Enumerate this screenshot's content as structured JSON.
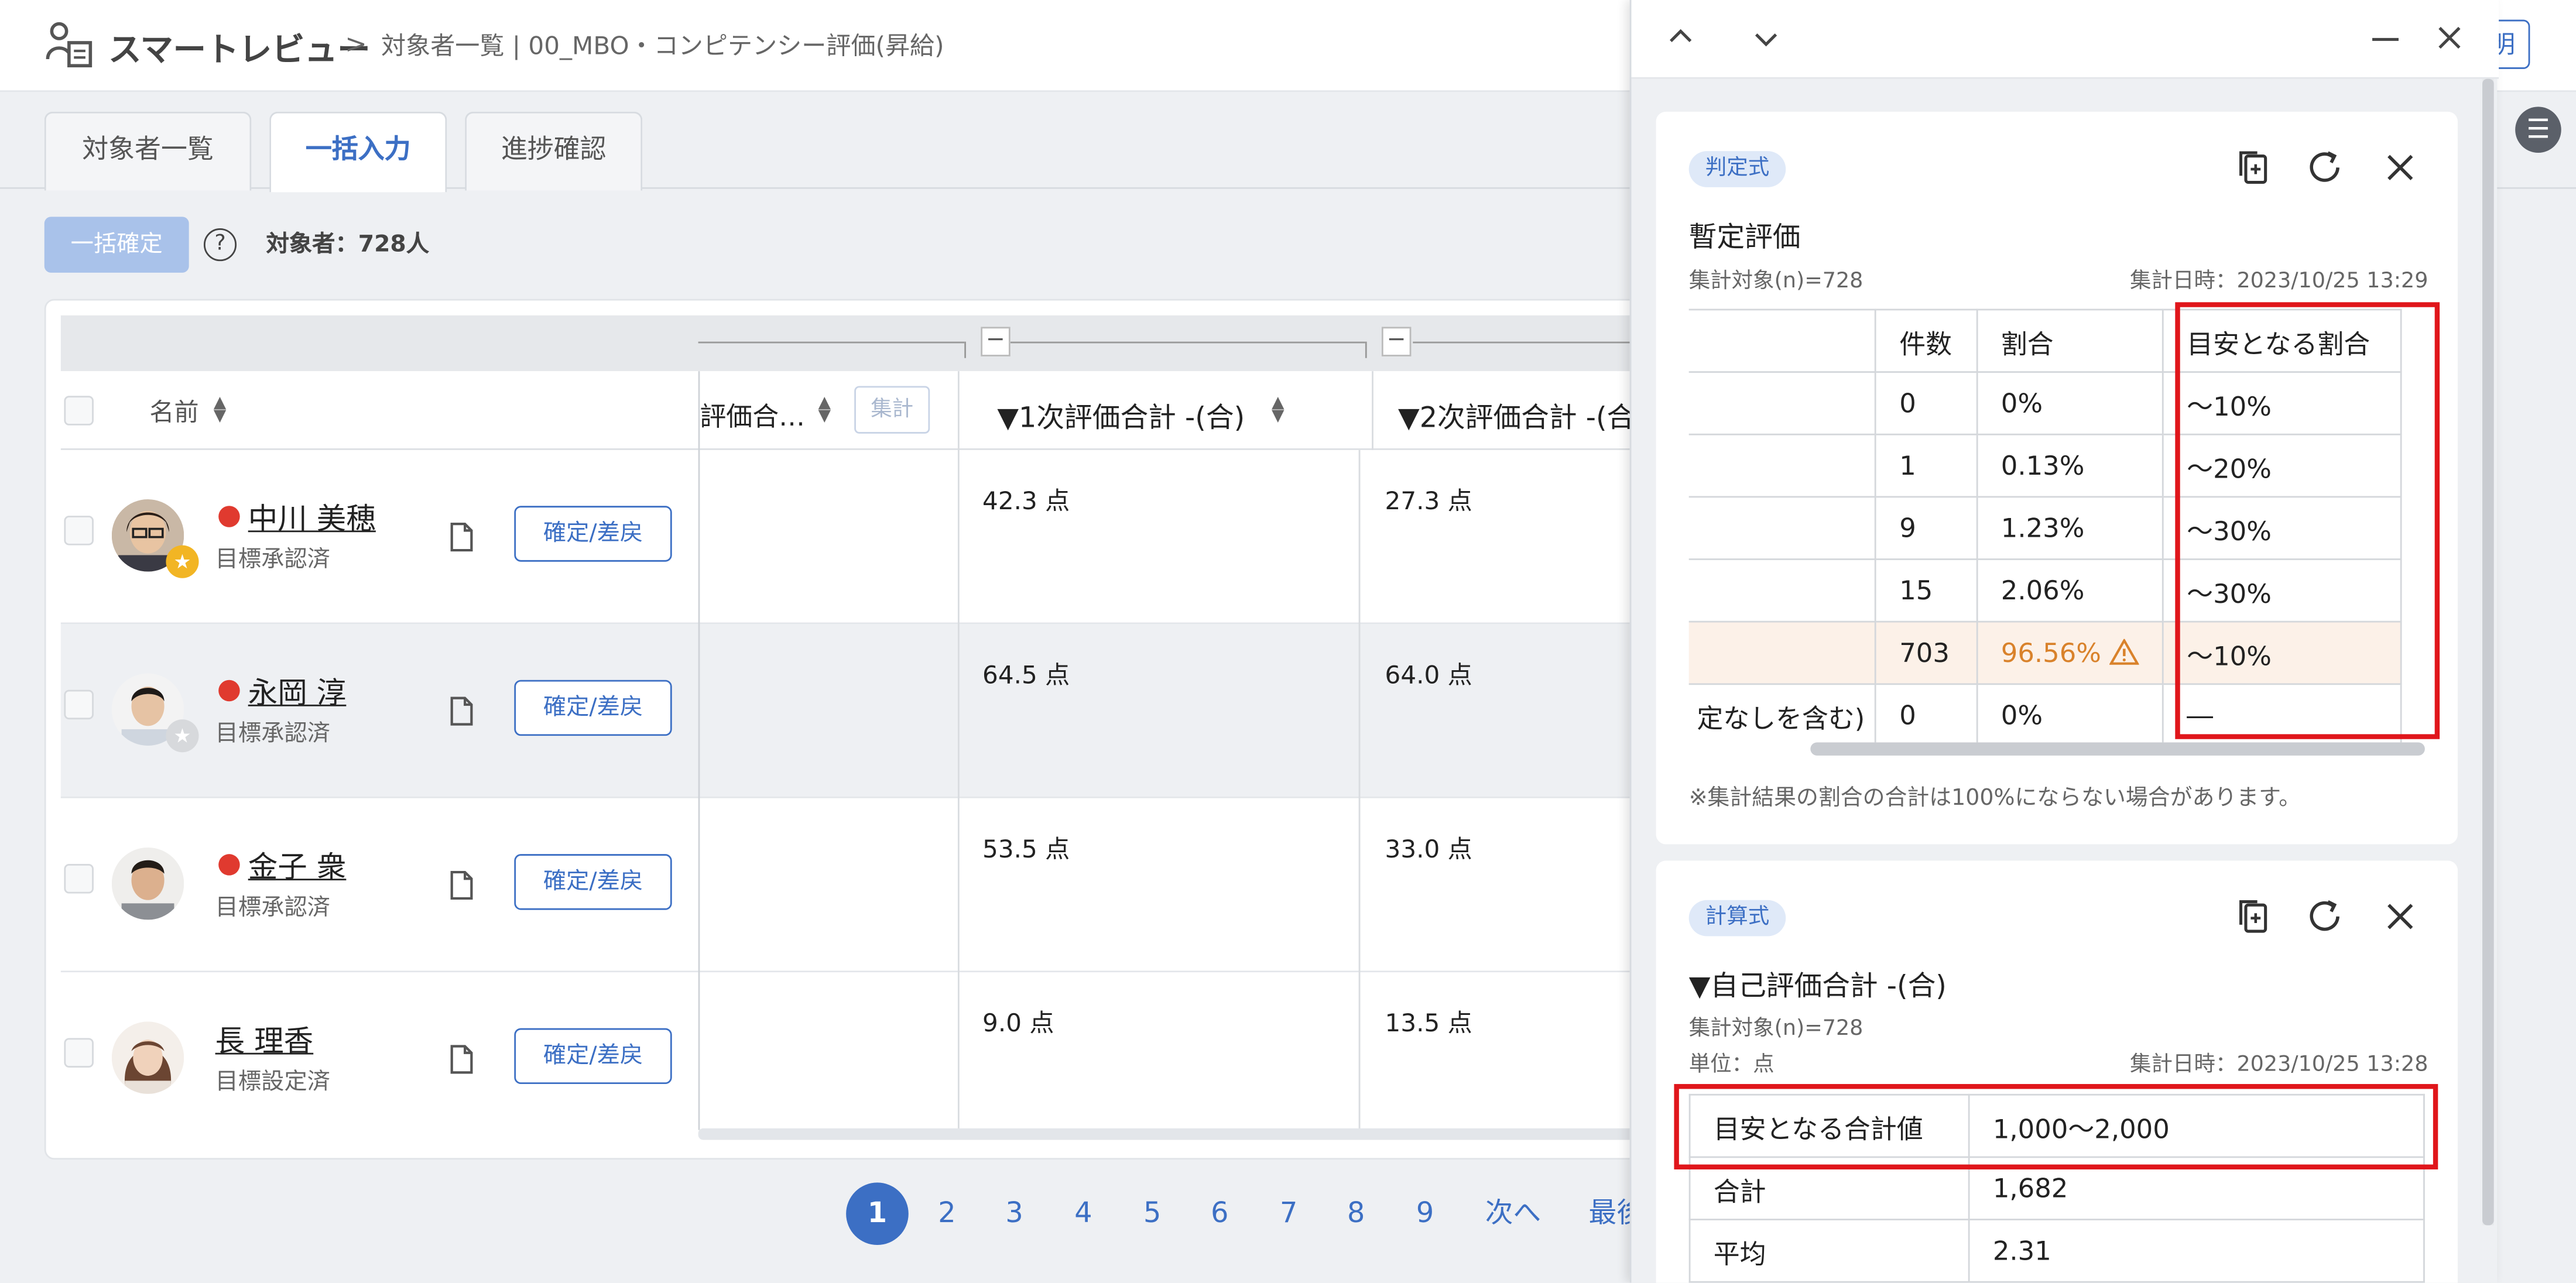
{
  "app": {
    "brand": "スマートレビュー",
    "breadcrumb_sep": ">",
    "breadcrumb": "対象者一覧 | 00_MBO・コンピテンシー評価(昇給)",
    "help_button": "明"
  },
  "tabs": [
    {
      "label": "対象者一覧",
      "active": false
    },
    {
      "label": "一括入力",
      "active": true
    },
    {
      "label": "進捗確認",
      "active": false
    }
  ],
  "toolbar": {
    "confirm_all": "一括確定",
    "help_icon": "?",
    "target_count": "対象者：728人"
  },
  "table": {
    "name_header": "名前",
    "self_eval_header": "評価合…",
    "agg_button": "集計",
    "first_eval_header": "▼1次評価合計 -(合)",
    "second_eval_header": "▼2次評価合計 -(合",
    "rows": [
      {
        "name": "中川 美穂",
        "status": "目標承認済",
        "action": "確定/差戻",
        "first": "42.3 点",
        "second": "27.3 点",
        "alert": true,
        "star": "gold"
      },
      {
        "name": "永岡 淳",
        "status": "目標承認済",
        "action": "確定/差戻",
        "first": "64.5 点",
        "second": "64.0 点",
        "alert": true,
        "star": "grey"
      },
      {
        "name": "金子 衆",
        "status": "目標承認済",
        "action": "確定/差戻",
        "first": "53.5 点",
        "second": "33.0 点",
        "alert": true,
        "star": ""
      },
      {
        "name": "長 理香",
        "status": "目標設定済",
        "action": "確定/差戻",
        "first": "9.0 点",
        "second": "13.5 点",
        "alert": false,
        "star": ""
      }
    ]
  },
  "pagination": {
    "current": "1",
    "pages": [
      "2",
      "3",
      "4",
      "5",
      "6",
      "7",
      "8",
      "9"
    ],
    "next": "次へ",
    "last": "最後"
  },
  "panel": {
    "card1": {
      "badge": "判定式",
      "title": "暫定評価",
      "population": "集計対象(n)=728",
      "date": "集計日時：2023/10/25 13:29",
      "headers": [
        "",
        "件数",
        "割合",
        "目安となる割合"
      ],
      "rows": [
        {
          "label": "",
          "count": "0",
          "ratio": "0%",
          "target": "〜10%",
          "warn": false
        },
        {
          "label": "",
          "count": "1",
          "ratio": "0.13%",
          "target": "〜20%",
          "warn": false
        },
        {
          "label": "",
          "count": "9",
          "ratio": "1.23%",
          "target": "〜30%",
          "warn": false
        },
        {
          "label": "",
          "count": "15",
          "ratio": "2.06%",
          "target": "〜30%",
          "warn": false
        },
        {
          "label": "",
          "count": "703",
          "ratio": "96.56%",
          "target": "〜10%",
          "warn": true
        },
        {
          "label": "定なしを含む)",
          "count": "0",
          "ratio": "0%",
          "target": "―",
          "warn": false
        }
      ],
      "note": "※集計結果の割合の合計は100%にならない場合があります。"
    },
    "card2": {
      "badge": "計算式",
      "title": "▼自己評価合計 -(合)",
      "population": "集計対象(n)=728",
      "unit": "単位：点",
      "date": "集計日時：2023/10/25 13:28",
      "rows": [
        {
          "label": "目安となる合計値",
          "value": "1,000〜2,000"
        },
        {
          "label": "合計",
          "value": "1,682"
        },
        {
          "label": "平均",
          "value": "2.31"
        }
      ]
    }
  },
  "colors": {
    "accent": "#3c6fc4",
    "alert": "#e03a2f",
    "warn": "#d9822b",
    "highlight_box": "#e0161b"
  }
}
